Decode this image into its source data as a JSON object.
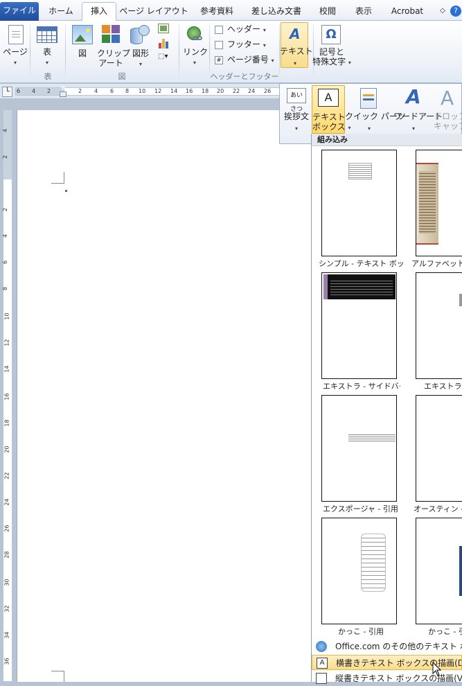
{
  "tabs": [
    "ファイル",
    "ホーム",
    "挿入",
    "ページ レイアウト",
    "参考資料",
    "差し込み文書",
    "校閲",
    "表示",
    "Acrobat"
  ],
  "ribbon": {
    "page_label": "ページ",
    "table_label": "表",
    "table_group": "表",
    "picture_label": "図",
    "clipart_label1": "クリップ",
    "clipart_label2": "アート",
    "shapes_label": "図形",
    "illust_group": "図",
    "link_label": "リンク",
    "header_label": "ヘッダー",
    "footer_label": "フッター",
    "pagenum_label": "ページ番号",
    "hf_group": "ヘッダーとフッター",
    "text_label": "テキスト",
    "symbol_label1": "記号と",
    "symbol_label2": "特殊文字"
  },
  "text_panel": {
    "greeting_label": "挨拶文",
    "textbox_label1": "テキスト",
    "textbox_label2": "ボックス",
    "quickparts_label": "クイック パーツ",
    "wordart_label": "ワードアート",
    "dropcap_label1": "ドロップ",
    "dropcap_label2": "キャップ",
    "greeting_icon_text": "あいさつ"
  },
  "ruler": {
    "h_numbers": [
      "6",
      "4",
      "2",
      "2",
      "4",
      "6",
      "8",
      "10",
      "12",
      "14",
      "16",
      "18",
      "20",
      "22",
      "24",
      "26"
    ],
    "v_numbers": [
      "4",
      "2",
      "2",
      "4",
      "6",
      "8",
      "10",
      "12",
      "14",
      "16",
      "18",
      "20",
      "22",
      "24",
      "26",
      "28",
      "30",
      "32",
      "34",
      "36"
    ]
  },
  "gallery": {
    "header": "組み込み",
    "captions": [
      "シンプル - テキスト ボッ…",
      "アルファベット -",
      "エキストラ - サイドバー",
      "エキストラ -",
      "エクスポージャ - 引用",
      "オースティン - 引",
      "かっこ - 引用",
      "かっこ - 引"
    ]
  },
  "menu": {
    "more_label": "Office.com のその他のテキスト ボック",
    "draw_h_label": "横書きテキスト ボックスの描画(D)",
    "draw_v_label": "縦書きテキスト ボックスの描画(V)"
  }
}
